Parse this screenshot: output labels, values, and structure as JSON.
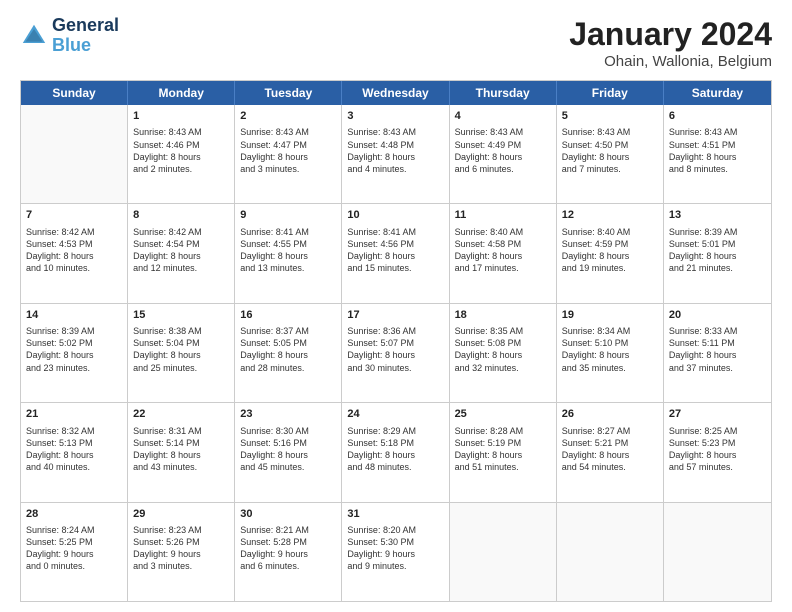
{
  "header": {
    "logo_line1": "General",
    "logo_line2": "Blue",
    "main_title": "January 2024",
    "subtitle": "Ohain, Wallonia, Belgium"
  },
  "calendar": {
    "weekdays": [
      "Sunday",
      "Monday",
      "Tuesday",
      "Wednesday",
      "Thursday",
      "Friday",
      "Saturday"
    ],
    "weeks": [
      [
        {
          "day": "",
          "empty": true
        },
        {
          "day": "1",
          "sunrise": "Sunrise: 8:43 AM",
          "sunset": "Sunset: 4:46 PM",
          "daylight": "Daylight: 8 hours and 2 minutes."
        },
        {
          "day": "2",
          "sunrise": "Sunrise: 8:43 AM",
          "sunset": "Sunset: 4:47 PM",
          "daylight": "Daylight: 8 hours and 3 minutes."
        },
        {
          "day": "3",
          "sunrise": "Sunrise: 8:43 AM",
          "sunset": "Sunset: 4:48 PM",
          "daylight": "Daylight: 8 hours and 4 minutes."
        },
        {
          "day": "4",
          "sunrise": "Sunrise: 8:43 AM",
          "sunset": "Sunset: 4:49 PM",
          "daylight": "Daylight: 8 hours and 6 minutes."
        },
        {
          "day": "5",
          "sunrise": "Sunrise: 8:43 AM",
          "sunset": "Sunset: 4:50 PM",
          "daylight": "Daylight: 8 hours and 7 minutes."
        },
        {
          "day": "6",
          "sunrise": "Sunrise: 8:43 AM",
          "sunset": "Sunset: 4:51 PM",
          "daylight": "Daylight: 8 hours and 8 minutes."
        }
      ],
      [
        {
          "day": "7",
          "sunrise": "Sunrise: 8:42 AM",
          "sunset": "Sunset: 4:53 PM",
          "daylight": "Daylight: 8 hours and 10 minutes."
        },
        {
          "day": "8",
          "sunrise": "Sunrise: 8:42 AM",
          "sunset": "Sunset: 4:54 PM",
          "daylight": "Daylight: 8 hours and 12 minutes."
        },
        {
          "day": "9",
          "sunrise": "Sunrise: 8:41 AM",
          "sunset": "Sunset: 4:55 PM",
          "daylight": "Daylight: 8 hours and 13 minutes."
        },
        {
          "day": "10",
          "sunrise": "Sunrise: 8:41 AM",
          "sunset": "Sunset: 4:56 PM",
          "daylight": "Daylight: 8 hours and 15 minutes."
        },
        {
          "day": "11",
          "sunrise": "Sunrise: 8:40 AM",
          "sunset": "Sunset: 4:58 PM",
          "daylight": "Daylight: 8 hours and 17 minutes."
        },
        {
          "day": "12",
          "sunrise": "Sunrise: 8:40 AM",
          "sunset": "Sunset: 4:59 PM",
          "daylight": "Daylight: 8 hours and 19 minutes."
        },
        {
          "day": "13",
          "sunrise": "Sunrise: 8:39 AM",
          "sunset": "Sunset: 5:01 PM",
          "daylight": "Daylight: 8 hours and 21 minutes."
        }
      ],
      [
        {
          "day": "14",
          "sunrise": "Sunrise: 8:39 AM",
          "sunset": "Sunset: 5:02 PM",
          "daylight": "Daylight: 8 hours and 23 minutes."
        },
        {
          "day": "15",
          "sunrise": "Sunrise: 8:38 AM",
          "sunset": "Sunset: 5:04 PM",
          "daylight": "Daylight: 8 hours and 25 minutes."
        },
        {
          "day": "16",
          "sunrise": "Sunrise: 8:37 AM",
          "sunset": "Sunset: 5:05 PM",
          "daylight": "Daylight: 8 hours and 28 minutes."
        },
        {
          "day": "17",
          "sunrise": "Sunrise: 8:36 AM",
          "sunset": "Sunset: 5:07 PM",
          "daylight": "Daylight: 8 hours and 30 minutes."
        },
        {
          "day": "18",
          "sunrise": "Sunrise: 8:35 AM",
          "sunset": "Sunset: 5:08 PM",
          "daylight": "Daylight: 8 hours and 32 minutes."
        },
        {
          "day": "19",
          "sunrise": "Sunrise: 8:34 AM",
          "sunset": "Sunset: 5:10 PM",
          "daylight": "Daylight: 8 hours and 35 minutes."
        },
        {
          "day": "20",
          "sunrise": "Sunrise: 8:33 AM",
          "sunset": "Sunset: 5:11 PM",
          "daylight": "Daylight: 8 hours and 37 minutes."
        }
      ],
      [
        {
          "day": "21",
          "sunrise": "Sunrise: 8:32 AM",
          "sunset": "Sunset: 5:13 PM",
          "daylight": "Daylight: 8 hours and 40 minutes."
        },
        {
          "day": "22",
          "sunrise": "Sunrise: 8:31 AM",
          "sunset": "Sunset: 5:14 PM",
          "daylight": "Daylight: 8 hours and 43 minutes."
        },
        {
          "day": "23",
          "sunrise": "Sunrise: 8:30 AM",
          "sunset": "Sunset: 5:16 PM",
          "daylight": "Daylight: 8 hours and 45 minutes."
        },
        {
          "day": "24",
          "sunrise": "Sunrise: 8:29 AM",
          "sunset": "Sunset: 5:18 PM",
          "daylight": "Daylight: 8 hours and 48 minutes."
        },
        {
          "day": "25",
          "sunrise": "Sunrise: 8:28 AM",
          "sunset": "Sunset: 5:19 PM",
          "daylight": "Daylight: 8 hours and 51 minutes."
        },
        {
          "day": "26",
          "sunrise": "Sunrise: 8:27 AM",
          "sunset": "Sunset: 5:21 PM",
          "daylight": "Daylight: 8 hours and 54 minutes."
        },
        {
          "day": "27",
          "sunrise": "Sunrise: 8:25 AM",
          "sunset": "Sunset: 5:23 PM",
          "daylight": "Daylight: 8 hours and 57 minutes."
        }
      ],
      [
        {
          "day": "28",
          "sunrise": "Sunrise: 8:24 AM",
          "sunset": "Sunset: 5:25 PM",
          "daylight": "Daylight: 9 hours and 0 minutes."
        },
        {
          "day": "29",
          "sunrise": "Sunrise: 8:23 AM",
          "sunset": "Sunset: 5:26 PM",
          "daylight": "Daylight: 9 hours and 3 minutes."
        },
        {
          "day": "30",
          "sunrise": "Sunrise: 8:21 AM",
          "sunset": "Sunset: 5:28 PM",
          "daylight": "Daylight: 9 hours and 6 minutes."
        },
        {
          "day": "31",
          "sunrise": "Sunrise: 8:20 AM",
          "sunset": "Sunset: 5:30 PM",
          "daylight": "Daylight: 9 hours and 9 minutes."
        },
        {
          "day": "",
          "empty": true
        },
        {
          "day": "",
          "empty": true
        },
        {
          "day": "",
          "empty": true
        }
      ]
    ]
  }
}
